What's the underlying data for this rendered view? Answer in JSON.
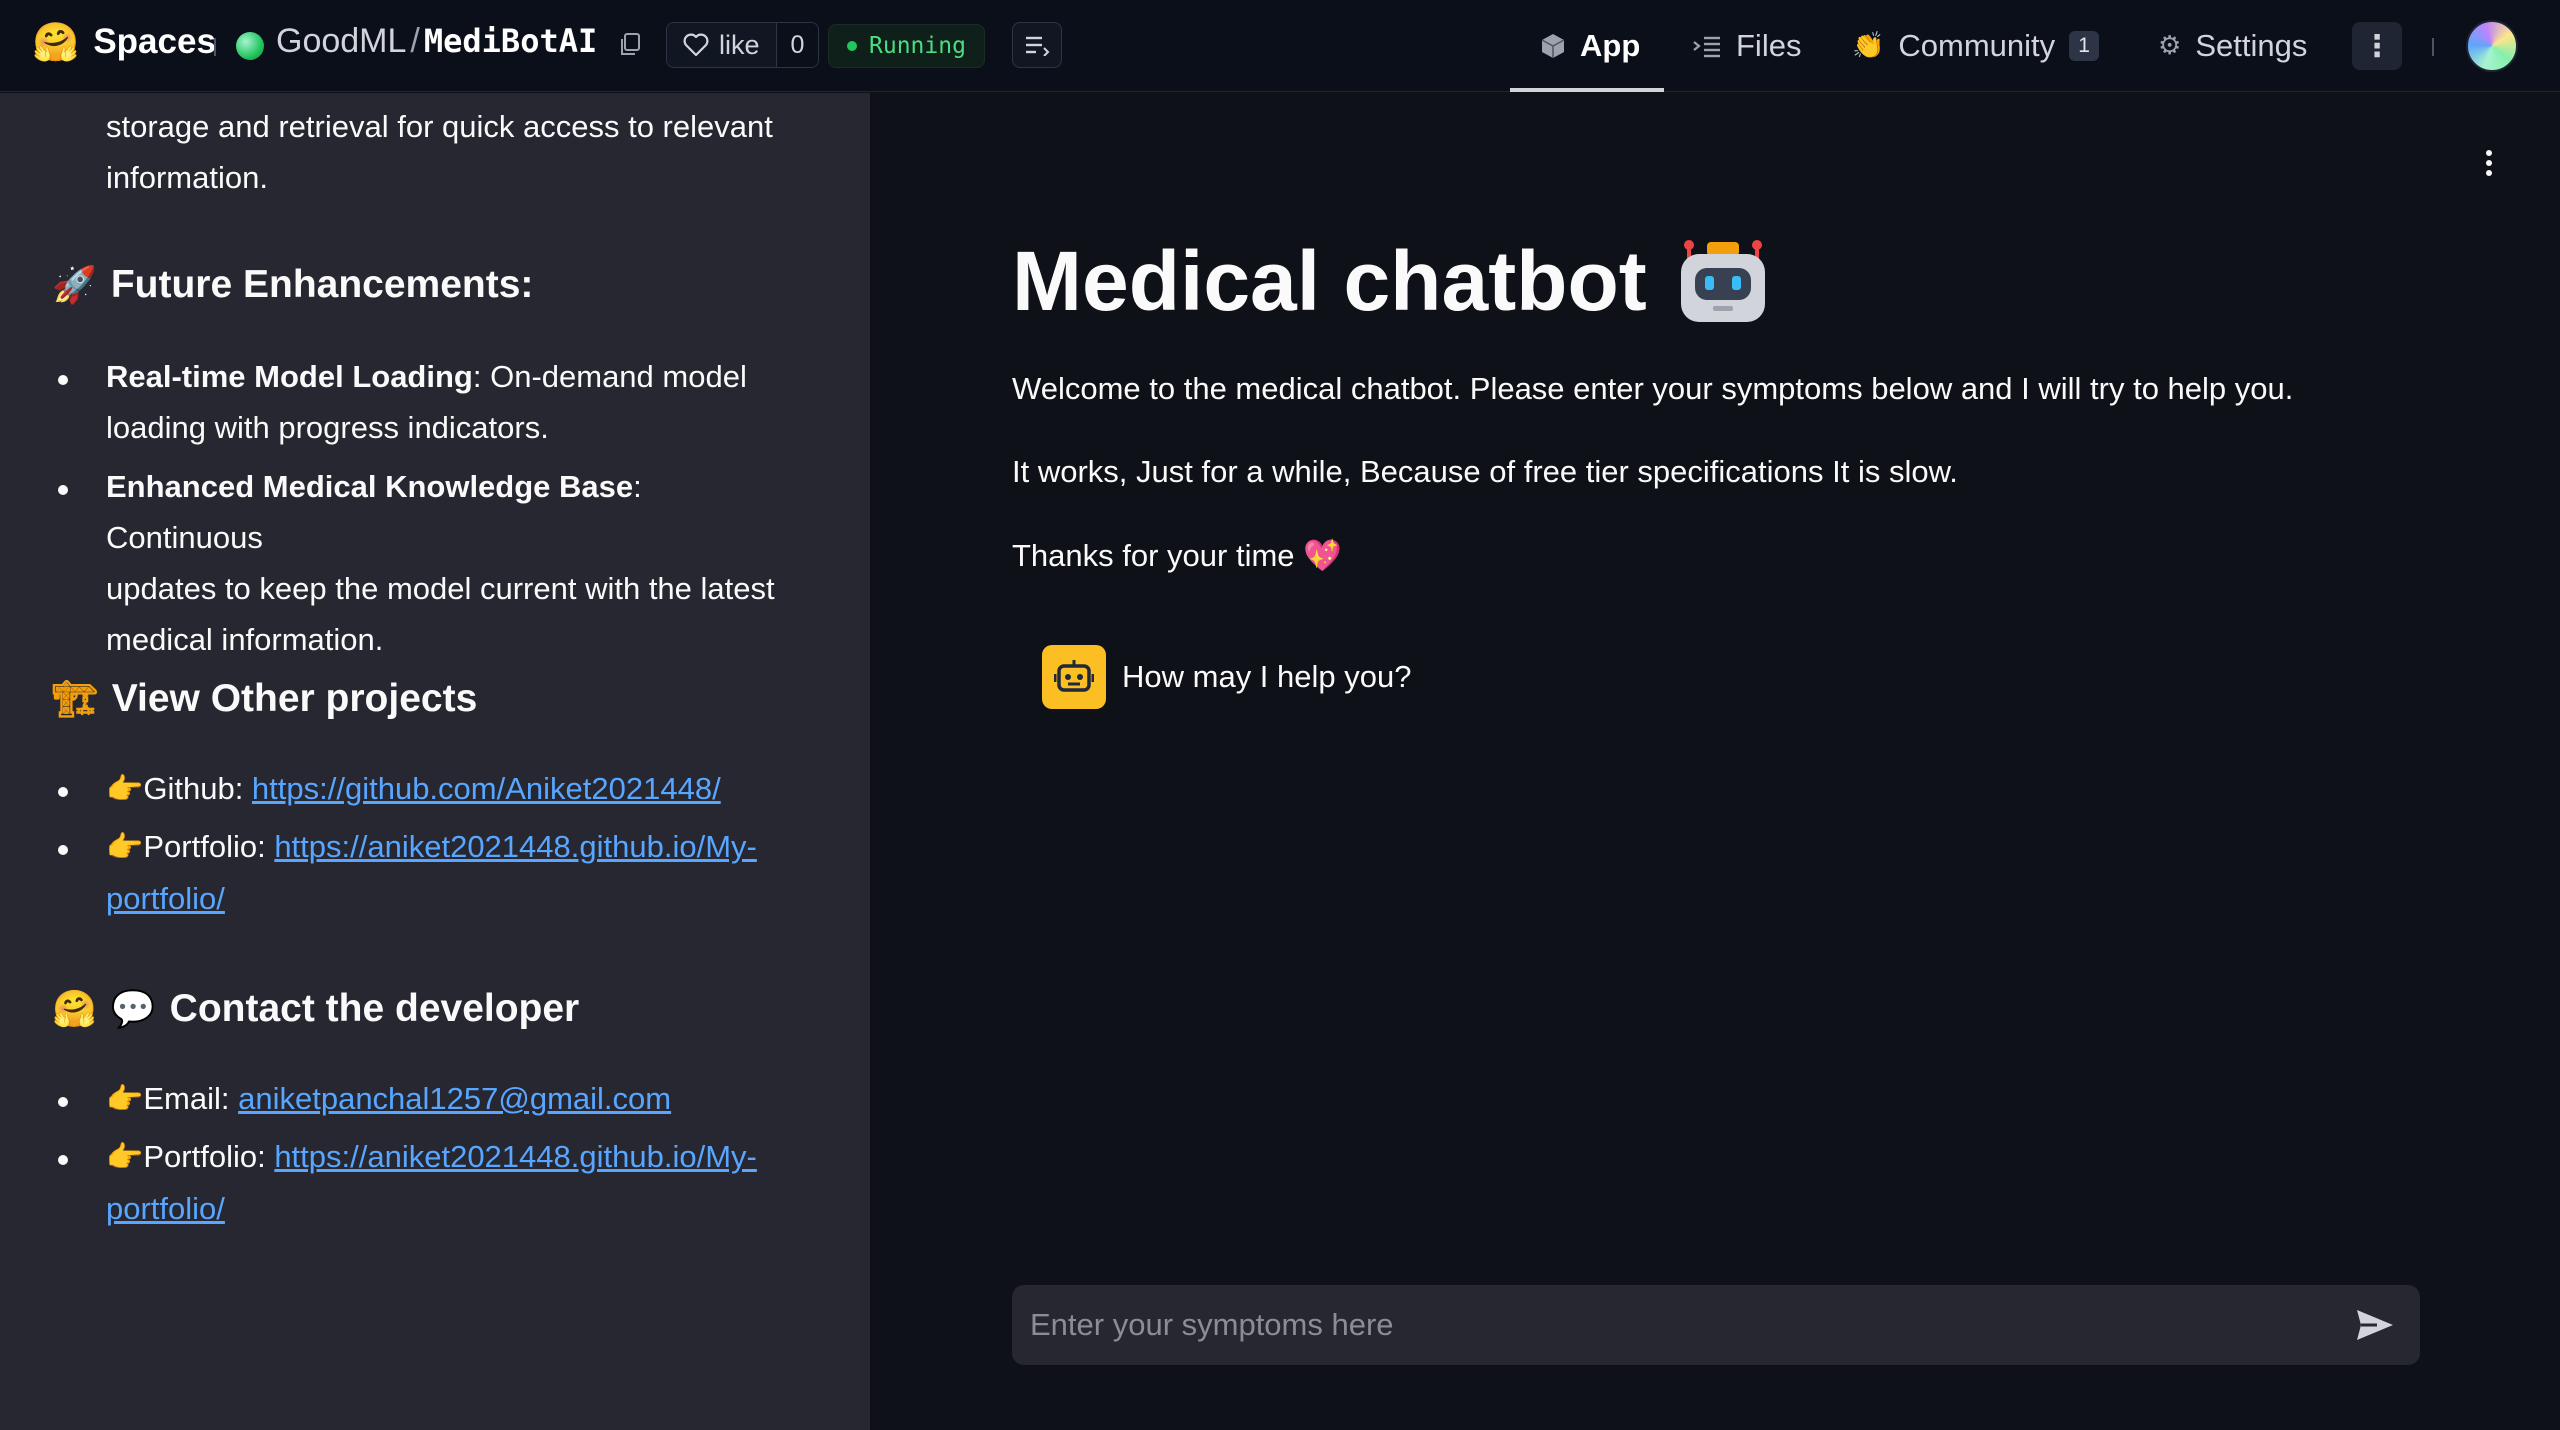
{
  "topbar": {
    "brand": "Spaces",
    "org": "GoodML",
    "repo": "MediBotAI",
    "like_label": "like",
    "like_count": "0",
    "status": "Running",
    "nav": {
      "app": "App",
      "files": "Files",
      "community": "Community",
      "community_count": "1",
      "settings": "Settings"
    },
    "more_label": "⋮"
  },
  "sidebar": {
    "intro_line1": "storage and retrieval for quick access to relevant",
    "intro_line2": "information.",
    "future": {
      "icon": "🚀",
      "heading": "Future Enhancements:",
      "items": [
        {
          "bold": "Real-time Model Loading",
          "rest": ": On-demand model",
          "rest2": "loading with progress indicators."
        },
        {
          "bold": "Enhanced Medical Knowledge Base",
          "rest": ": Continuous",
          "rest2": "updates to keep the model current with the latest",
          "rest3": "medical information."
        }
      ]
    },
    "projects": {
      "icon": "🏗",
      "heading": "View Other projects",
      "github_label": "Github: ",
      "github_url": "https://github.com/Aniket2021448/",
      "portfolio_label": "Portfolio: ",
      "portfolio_url_a": "https://aniket2021448.github.io/My-",
      "portfolio_url_b": "portfolio/"
    },
    "contact": {
      "icon": "🤗",
      "icon2": "💬",
      "heading": "Contact the developer",
      "email_label": "Email: ",
      "email": "aniketpanchal1257@gmail.com",
      "portfolio_label": "Portfolio: ",
      "portfolio_url_a": "https://aniket2021448.github.io/My-",
      "portfolio_url_b": "portfolio/"
    },
    "pointer": "👉"
  },
  "main": {
    "title": "Medical chatbot",
    "welcome": "Welcome to the medical chatbot. Please enter your symptoms below and I will try to help you.",
    "note": "It works, Just for a while, Because of free tier specifications It is slow.",
    "thanks": "Thanks for your time",
    "thanks_emoji": "💖",
    "assistant_message": "How may I help you?",
    "input_placeholder": "Enter your symptoms here"
  }
}
